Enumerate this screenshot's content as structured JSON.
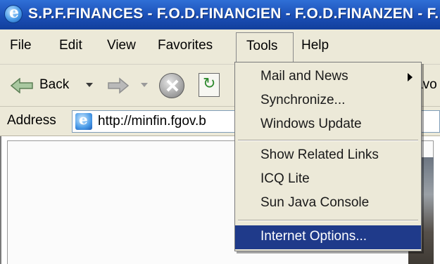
{
  "window": {
    "title": "S.P.F.FINANCES - F.O.D.FINANCIEN - F.O.D.FINANZEN - F."
  },
  "menubar": {
    "items": [
      "File",
      "Edit",
      "View",
      "Favorites",
      "Tools",
      "Help"
    ]
  },
  "toolbar": {
    "back_label": "Back",
    "favorites_partial": "avo"
  },
  "address": {
    "label": "Address",
    "url": "http://minfin.fgov.b"
  },
  "tools_menu": {
    "items": [
      {
        "label": "Mail and News",
        "submenu": true
      },
      {
        "label": "Synchronize..."
      },
      {
        "label": "Windows Update"
      },
      {
        "label": "Show Related Links"
      },
      {
        "label": "ICQ Lite"
      },
      {
        "label": "Sun Java Console"
      },
      {
        "label": "Internet Options...",
        "highlighted": true
      }
    ]
  },
  "colors": {
    "titlebar": "#1b4fb6",
    "menu_bg": "#ece9d8",
    "highlight": "#1f3a8a"
  }
}
